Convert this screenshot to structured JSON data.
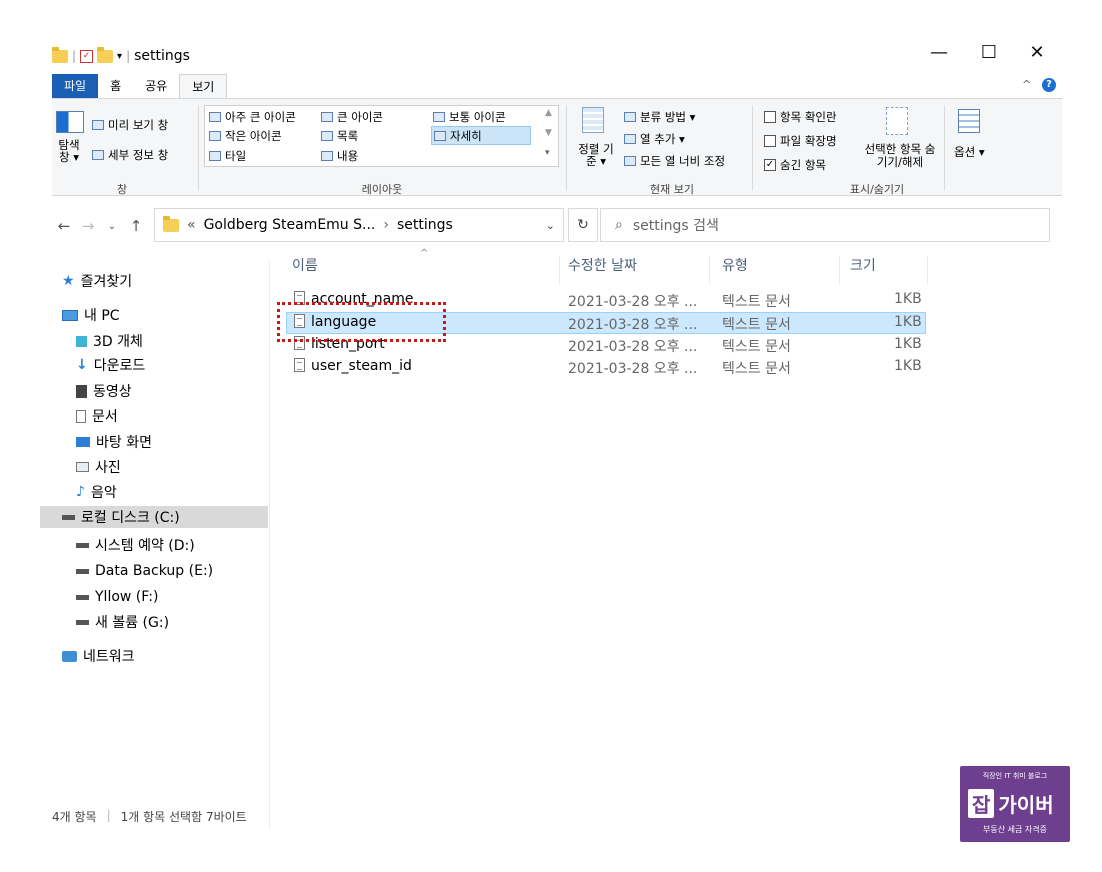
{
  "window": {
    "title": "settings",
    "controls": {
      "minimize": "—",
      "maximize": "☐",
      "close": "✕"
    }
  },
  "ribbon_tabs": [
    {
      "label": "파일"
    },
    {
      "label": "홈"
    },
    {
      "label": "공유"
    },
    {
      "label": "보기"
    }
  ],
  "ribbon": {
    "pane": {
      "nav_pane_label": "탐색 창 ▾",
      "preview_pane": "미리 보기 창",
      "details_pane": "세부 정보 창",
      "group_label": "창"
    },
    "layout": {
      "items": [
        "아주 큰 아이콘",
        "큰 아이콘",
        "보통 아이콘",
        "작은 아이콘",
        "목록",
        "자세히",
        "타일",
        "내용"
      ],
      "selected": "자세히",
      "group_label": "레이아웃"
    },
    "current_view": {
      "sort_by": "정렬 기준 ▾",
      "group_by": "분류 방법 ▾",
      "add_columns": "열 추가 ▾",
      "size_all_columns": "모든 열 너비 조정",
      "group_label": "현재 보기"
    },
    "show_hide": {
      "item_checkboxes": "항목 확인란",
      "file_extensions": "파일 확장명",
      "hidden_items": "숨긴 항목",
      "hide_selected": "선택한 항목 숨기기/해제",
      "group_label": "표시/숨기기"
    },
    "options": {
      "label": "옵션 ▾"
    }
  },
  "address_bar": {
    "path_prefix": "«",
    "path_parent": "Goldberg SteamEmu S...",
    "path_current": "settings",
    "search_placeholder": "settings 검색"
  },
  "sidebar": {
    "items": [
      {
        "label": "즐겨찾기",
        "icon": "star-icon"
      },
      {
        "label": "내 PC",
        "icon": "pc-icon"
      },
      {
        "label": "3D 개체",
        "icon": "3d-objects-icon"
      },
      {
        "label": "다운로드",
        "icon": "download-icon"
      },
      {
        "label": "동영상",
        "icon": "video-icon"
      },
      {
        "label": "문서",
        "icon": "document-icon"
      },
      {
        "label": "바탕 화면",
        "icon": "desktop-icon"
      },
      {
        "label": "사진",
        "icon": "pictures-icon"
      },
      {
        "label": "음악",
        "icon": "music-icon"
      },
      {
        "label": "로컬 디스크 (C:)",
        "icon": "drive-icon"
      },
      {
        "label": "시스템 예약 (D:)",
        "icon": "drive-icon"
      },
      {
        "label": "Data Backup (E:)",
        "icon": "drive-icon"
      },
      {
        "label": "Yllow (F:)",
        "icon": "drive-icon"
      },
      {
        "label": "새 볼륨 (G:)",
        "icon": "drive-icon"
      },
      {
        "label": "네트워크",
        "icon": "network-icon"
      }
    ]
  },
  "columns": {
    "name": "이름",
    "date": "수정한 날짜",
    "type": "유형",
    "size": "크기"
  },
  "files": [
    {
      "name": "account_name",
      "date": "2021-03-28 오후 ...",
      "type": "텍스트 문서",
      "size": "1KB"
    },
    {
      "name": "language",
      "date": "2021-03-28 오후 ...",
      "type": "텍스트 문서",
      "size": "1KB"
    },
    {
      "name": "listen_port",
      "date": "2021-03-28 오후 ...",
      "type": "텍스트 문서",
      "size": "1KB"
    },
    {
      "name": "user_steam_id",
      "date": "2021-03-28 오후 ...",
      "type": "텍스트 문서",
      "size": "1KB"
    }
  ],
  "status_bar": {
    "item_count": "4개 항목",
    "selection": "1개 항목 선택함 7바이트"
  },
  "watermark": {
    "tagline": "직장인 IT 취미 블로그",
    "logo_char": "잡",
    "logo_text": "가이버",
    "bottom": "부동산 세금 자격증"
  },
  "colors": {
    "file_tab": "#1a5fb4",
    "selection": "#cce8ff",
    "highlight_box": "#c41a1a",
    "watermark_bg": "#6f3f8f"
  }
}
